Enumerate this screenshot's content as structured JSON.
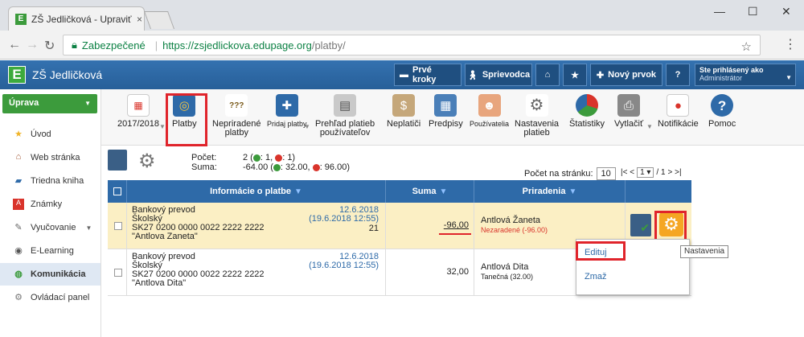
{
  "browser": {
    "tab_title": "ZŠ Jedličková - Upraviť v...",
    "tab_close": "×",
    "secure_label": "Zabezpečené",
    "url_host": "https://zsjedlickova.edupage.org",
    "url_path": "/platby/",
    "win_min": "—",
    "win_max": "☐",
    "win_close": "✕"
  },
  "header": {
    "app_logo": "E",
    "app_name": "ZŠ Jedličková",
    "buttons": {
      "prve_kroky": "Prvé kroky",
      "sprievodca": "Sprievodca",
      "novy_prvok": "Nový prvok",
      "help": "?"
    },
    "user": {
      "line1": "Ste prihlásený ako",
      "line2": "Administrátor"
    }
  },
  "sidebar": {
    "section": "Úprava",
    "items": [
      {
        "label": "Úvod",
        "icon": "star-icon"
      },
      {
        "label": "Web stránka",
        "icon": "web-icon"
      },
      {
        "label": "Triedna kniha",
        "icon": "book-icon"
      },
      {
        "label": "Známky",
        "icon": "grade-icon"
      },
      {
        "label": "Vyučovanie",
        "icon": "teaching-icon"
      },
      {
        "label": "E-Learning",
        "icon": "elearning-icon"
      },
      {
        "label": "Komunikácia",
        "icon": "communication-icon"
      },
      {
        "label": "Ovládací panel",
        "icon": "control-panel-icon"
      }
    ]
  },
  "toolbar": {
    "year": "2017/2018",
    "platby": "Platby",
    "nepriradene_1": "Nepriradené",
    "nepriradene_2": "platby",
    "pridaj": "Pridaj platby",
    "prehlad_1": "Prehľad platieb",
    "prehlad_2": "používateľov",
    "neplatici": "Neplatiči",
    "predpisy": "Predpisy",
    "pouzivatelia": "Používatelia",
    "nastavenia_1": "Nastavenia",
    "nastavenia_2": "platieb",
    "statistiky": "Štatistiky",
    "vytlacit": "Vytlačiť",
    "notifikacie": "Notifikácie",
    "pomoc": "Pomoc",
    "year_icon_text": "▦",
    "nepriradene_icon_text": "???",
    "pomoc_icon_text": "?"
  },
  "summary": {
    "pocet_label": "Počet:",
    "suma_label": "Suma:",
    "pocet_value": "2 (",
    "pocet_plus": ": 1,",
    "pocet_minus": ": 1)",
    "suma_value": "-64.00 (",
    "suma_plus": ": 32.00,",
    "suma_minus": ": 96.00)",
    "per_page_label": "Počet na stránku:",
    "per_page_value": "10",
    "pager_prev": "|< <",
    "pager_page": "1 ▾",
    "pager_total": "/ 1",
    "pager_next": "> >|"
  },
  "table": {
    "headers": {
      "info": "Informácie o platbe",
      "suma": "Suma",
      "priradenia": "Priradenia"
    },
    "rows": [
      {
        "type": "Bankový prevod",
        "category": "Školský",
        "account": "SK27 0200 0000 0022 2222 2222",
        "note": "\"Antlova Zaneta\"",
        "date": "12.6.2018",
        "datetime": "(19.6.2018 12:55)",
        "ext": "21",
        "amount": "-96,00",
        "assigned": "Antlová Žaneta",
        "assigned_sub": "Nezaradené (-96.00)"
      },
      {
        "type": "Bankový prevod",
        "category": "Školský",
        "account": "SK27 0200 0000 0022 2222 2222",
        "note": "\"Antlova Dita\"",
        "date": "12.6.2018",
        "datetime": "(19.6.2018 12:55)",
        "ext": "",
        "amount": "32,00",
        "assigned": "Antlová Dita",
        "assigned_sub": "Tanečná (32.00)"
      }
    ]
  },
  "dropdown": {
    "edit": "Edituj",
    "delete": "Zmaž"
  },
  "tooltip": "Nastavenia",
  "colors": {
    "header_blue": "#2e6aa8",
    "green": "#3c9b3c",
    "highlight": "#fbefc4",
    "red": "#e0242b"
  }
}
